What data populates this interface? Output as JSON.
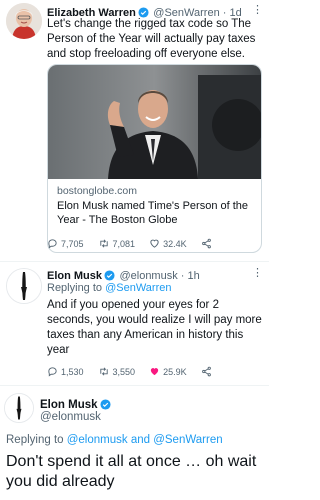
{
  "colors": {
    "accent": "#1d9bf0",
    "like_active": "#f91880",
    "text": "#0f1419",
    "muted": "#536471"
  },
  "tweet1": {
    "name": "Elizabeth Warren",
    "handle": "@SenWarren",
    "time": "1d",
    "text": "Let's change the rigged tax code so The Person of the Year will actually pay taxes and stop freeloading off everyone else.",
    "card": {
      "domain": "bostonglobe.com",
      "title": "Elon Musk named Time's Person of the Year - The Boston Globe"
    },
    "replies": "7,705",
    "retweets": "7,081",
    "likes": "32.4K"
  },
  "tweet2": {
    "name": "Elon Musk",
    "handle": "@elonmusk",
    "time": "1h",
    "replying_prefix": "Replying to ",
    "replying_to": "@SenWarren",
    "text": "And if you opened your eyes for 2 seconds, you would realize I will pay more taxes than any American in history this year",
    "replies": "1,530",
    "retweets": "3,550",
    "likes": "25.9K"
  },
  "tweet3": {
    "name": "Elon Musk",
    "handle": "@elonmusk",
    "replying_prefix": "Replying to ",
    "replying_to": "@elonmusk and @SenWarren",
    "text": "Don't spend it all at once … oh wait you did already"
  }
}
